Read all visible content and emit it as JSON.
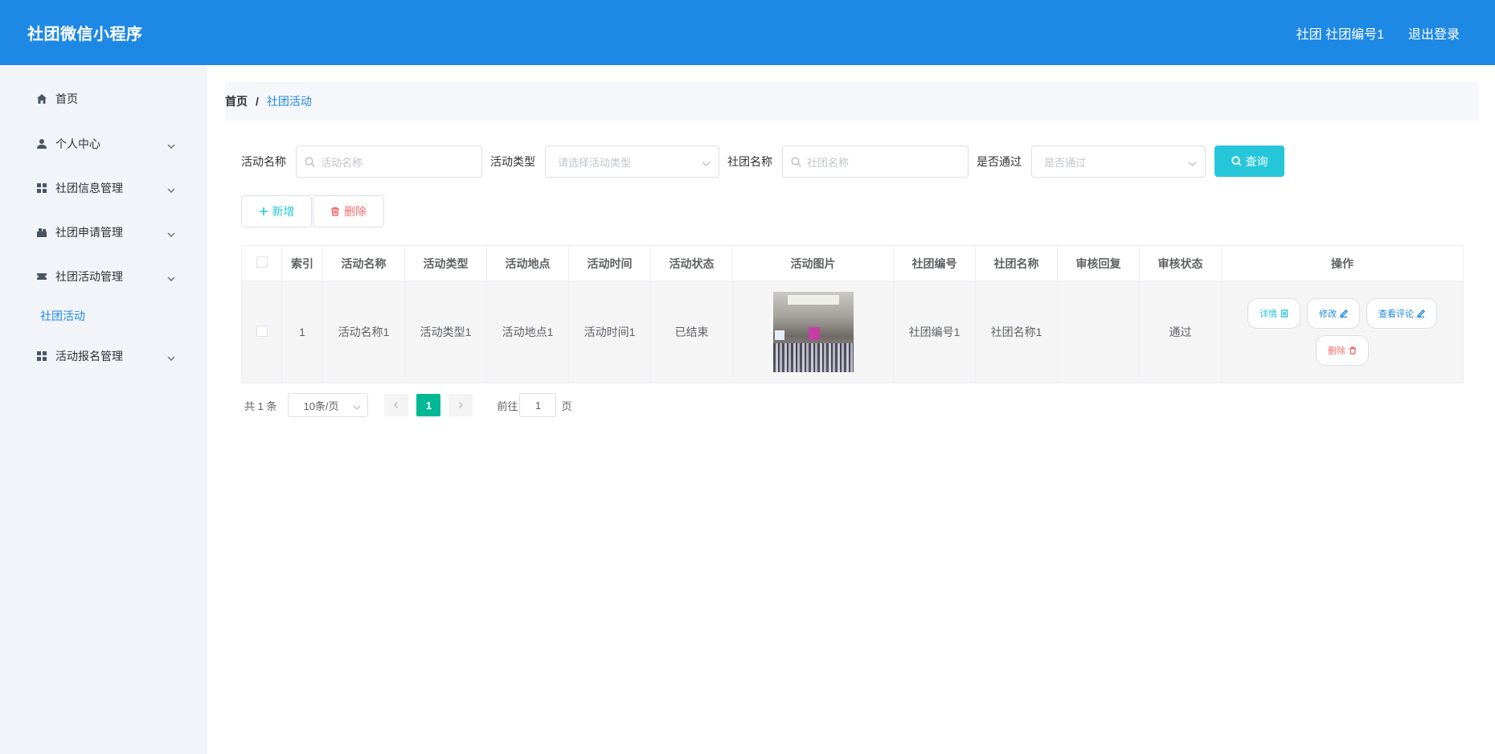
{
  "header": {
    "brand": "社团微信小程序",
    "user_info": "社团 社团编号1",
    "logout": "退出登录"
  },
  "sidebar": {
    "items": [
      {
        "label": "首页",
        "icon": "home-icon"
      },
      {
        "label": "个人中心",
        "icon": "user-icon"
      },
      {
        "label": "社团信息管理",
        "icon": "grid-icon"
      },
      {
        "label": "社团申请管理",
        "icon": "apply-icon"
      },
      {
        "label": "社团活动管理",
        "icon": "ticket-icon"
      },
      {
        "label": "活动报名管理",
        "icon": "grid-icon"
      }
    ],
    "active_sub": "社团活动"
  },
  "breadcrumb": {
    "home": "首页",
    "separator": "/",
    "current": "社团活动"
  },
  "filters": {
    "activity_name_label": "活动名称",
    "activity_name_placeholder": "活动名称",
    "activity_type_label": "活动类型",
    "activity_type_placeholder": "请选择活动类型",
    "club_name_label": "社团名称",
    "club_name_placeholder": "社团名称",
    "passed_label": "是否通过",
    "passed_placeholder": "是否通过",
    "query_button": "查询"
  },
  "actions": {
    "add": "新增",
    "delete": "删除"
  },
  "table": {
    "headers": [
      "索引",
      "活动名称",
      "活动类型",
      "活动地点",
      "活动时间",
      "活动状态",
      "活动图片",
      "社团编号",
      "社团名称",
      "审核回复",
      "审核状态",
      "操作"
    ],
    "rows": [
      {
        "index": "1",
        "name": "活动名称1",
        "type": "活动类型1",
        "location": "活动地点1",
        "time": "活动时间1",
        "status": "已结束",
        "club_no": "社团编号1",
        "club_name": "社团名称1",
        "review_reply": "",
        "review_status": "通过"
      }
    ],
    "op_buttons": {
      "detail": "详情",
      "edit": "修改",
      "comments": "查看评论",
      "delete": "删除"
    }
  },
  "pagination": {
    "total": "共 1 条",
    "page_size": "10条/页",
    "current_page": "1",
    "goto_label": "前往",
    "goto_value": "1",
    "page_unit": "页"
  },
  "colors": {
    "primary": "#1e88e5",
    "accent": "#26c6da",
    "danger": "#f56c6c",
    "page_active": "#00b894"
  }
}
